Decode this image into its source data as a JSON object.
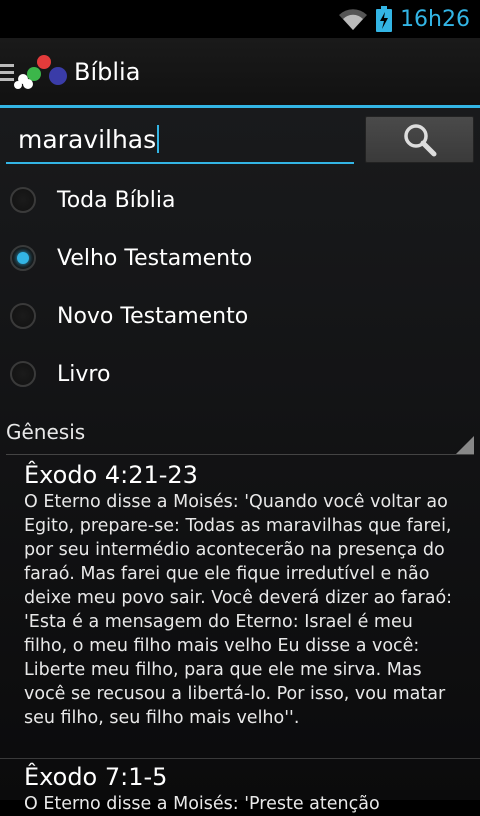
{
  "status_bar": {
    "time": "16h26",
    "icons": [
      "wifi-icon",
      "battery-charging-icon"
    ]
  },
  "action_bar": {
    "title": "Bíblia",
    "icons": [
      "menu-icon",
      "app-logo-icon"
    ]
  },
  "search": {
    "value": "maravilhas",
    "button_icon": "search-icon"
  },
  "scope_options": [
    {
      "label": "Toda Bíblia",
      "checked": false
    },
    {
      "label": "Velho Testamento",
      "checked": true
    },
    {
      "label": "Novo Testamento",
      "checked": false
    },
    {
      "label": "Livro",
      "checked": false
    }
  ],
  "book_spinner": {
    "selected": "Gênesis"
  },
  "results": [
    {
      "reference": "Êxodo 4:21-23",
      "text": "O Eterno disse a Moisés: 'Quando você voltar ao Egito, prepare-se: Todas as maravilhas que farei, por seu intermédio acontecerão na presença do faraó. Mas farei que ele fique irredutível e não deixe meu povo sair. Você deverá dizer ao faraó: 'Esta é a mensagem do Eterno: Israel é meu filho, o meu filho mais velho Eu disse a você: Liberte meu filho, para que ele me sirva. Mas você se recusou a libertá-lo. Por isso, vou matar seu filho, seu filho mais velho''."
    },
    {
      "reference": "Êxodo 7:1-5",
      "text": "O Eterno disse a Moisés: 'Preste atenção"
    }
  ],
  "colors": {
    "accent": "#33b5e5",
    "background": "#000000"
  }
}
